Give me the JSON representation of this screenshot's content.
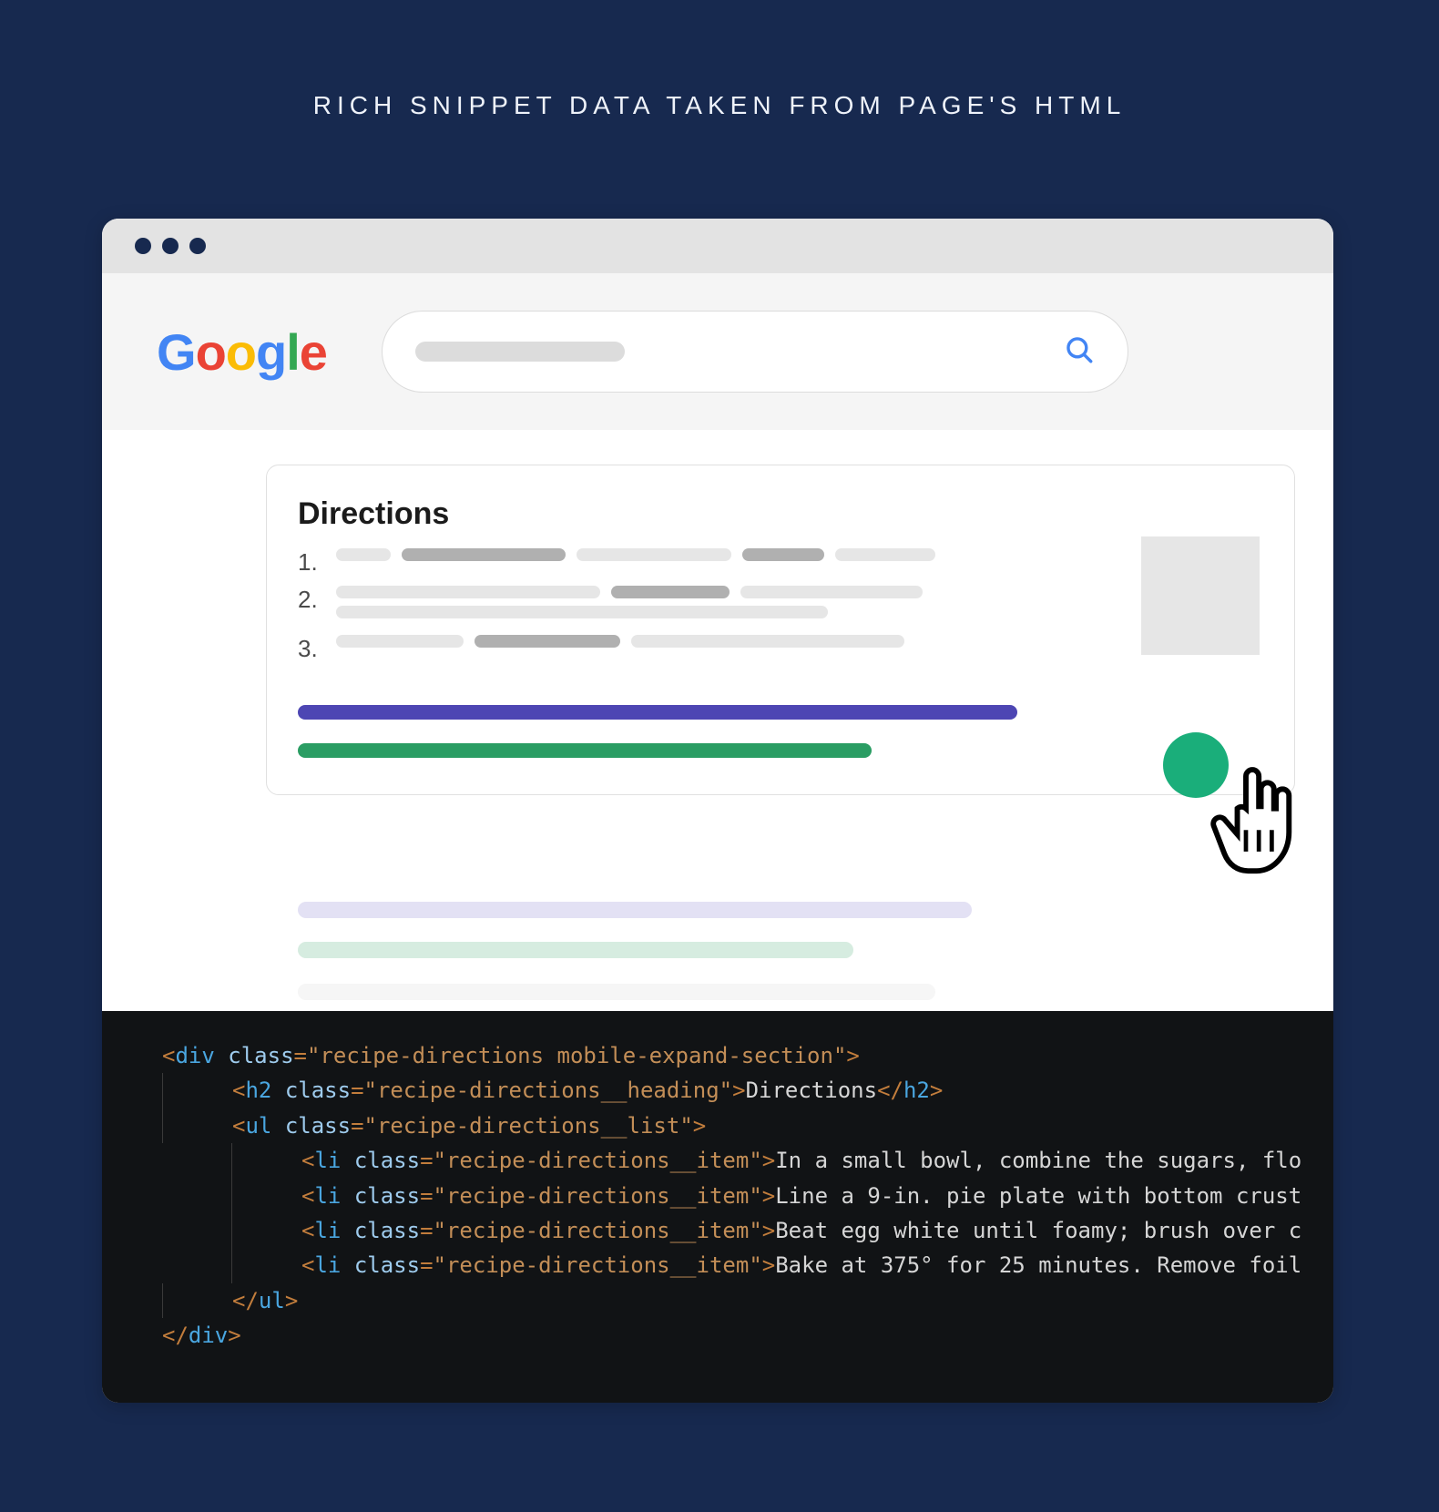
{
  "page_title": "RICH SNIPPET DATA TAKEN FROM PAGE'S HTML",
  "google_logo": "Google",
  "snippet": {
    "heading": "Directions",
    "steps": [
      "1.",
      "2.",
      "3."
    ]
  },
  "code": {
    "div_class": "recipe-directions mobile-expand-section",
    "h2_class": "recipe-directions__heading",
    "h2_text": "Directions",
    "ul_class": "recipe-directions__list",
    "li_class": "recipe-directions__item",
    "li_texts": [
      "In a small bowl, combine the sugars, flo",
      "Line a 9-in. pie plate with bottom crust",
      "Beat egg white until foamy; brush over c",
      "Bake at 375° for 25 minutes. Remove foil"
    ]
  }
}
